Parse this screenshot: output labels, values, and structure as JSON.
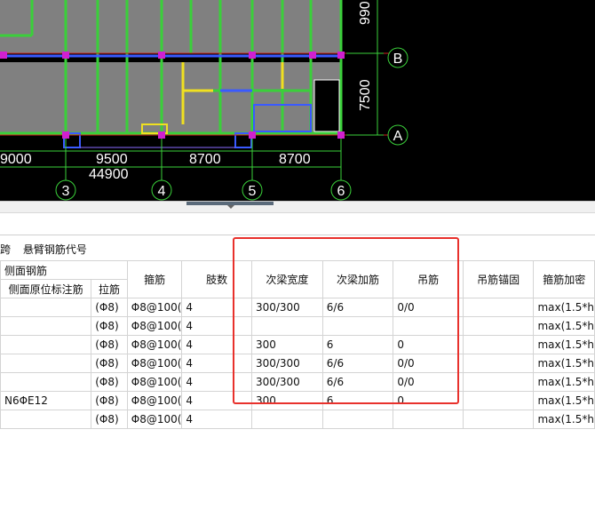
{
  "drawing": {
    "spans_bottom": [
      "9000",
      "9500",
      "8700",
      "8700"
    ],
    "total_span": "44900",
    "column_axes": [
      "3",
      "4",
      "5",
      "6"
    ],
    "row_axes": [
      "B",
      "A"
    ],
    "right_dims": [
      "990",
      "7500"
    ]
  },
  "toolbar": {
    "items": [
      "跨",
      "悬臂钢筋代号"
    ]
  },
  "grid": {
    "header_group": "侧面钢筋",
    "headers": {
      "side_orig": "侧面原位标注筋",
      "tie": "拉筋",
      "stirrup": "箍筋",
      "legs": "肢数",
      "sec_width": "次梁宽度",
      "sec_add": "次梁加筋",
      "hanger": "吊筋",
      "hanger_anchor": "吊筋锚固",
      "stirrup_dense": "箍筋加密"
    },
    "rows": [
      {
        "side": "",
        "tie": "(Φ8)",
        "stirrup": "Φ8@100(",
        "legs": "4",
        "width": "300/300",
        "add": "6/6",
        "hanger": "0/0",
        "anchor": "",
        "dense": "max(1.5*h"
      },
      {
        "side": "",
        "tie": "(Φ8)",
        "stirrup": "Φ8@100(",
        "legs": "4",
        "width": "",
        "add": "",
        "hanger": "",
        "anchor": "",
        "dense": "max(1.5*h"
      },
      {
        "side": "",
        "tie": "(Φ8)",
        "stirrup": "Φ8@100(",
        "legs": "4",
        "width": "300",
        "add": "6",
        "hanger": "0",
        "anchor": "",
        "dense": "max(1.5*h"
      },
      {
        "side": "",
        "tie": "(Φ8)",
        "stirrup": "Φ8@100(",
        "legs": "4",
        "width": "300/300",
        "add": "6/6",
        "hanger": "0/0",
        "anchor": "",
        "dense": "max(1.5*h"
      },
      {
        "side": "",
        "tie": "(Φ8)",
        "stirrup": "Φ8@100(",
        "legs": "4",
        "width": "300/300",
        "add": "6/6",
        "hanger": "0/0",
        "anchor": "",
        "dense": "max(1.5*h"
      },
      {
        "side": "N6ΦE12",
        "tie": "(Φ8)",
        "stirrup": "Φ8@100(",
        "legs": "4",
        "width": "300",
        "add": "6",
        "hanger": "0",
        "anchor": "",
        "dense": "max(1.5*h"
      },
      {
        "side": "",
        "tie": "(Φ8)",
        "stirrup": "Φ8@100(",
        "legs": "4",
        "width": "",
        "add": "",
        "hanger": "",
        "anchor": "",
        "dense": "max(1.5*h"
      }
    ]
  }
}
